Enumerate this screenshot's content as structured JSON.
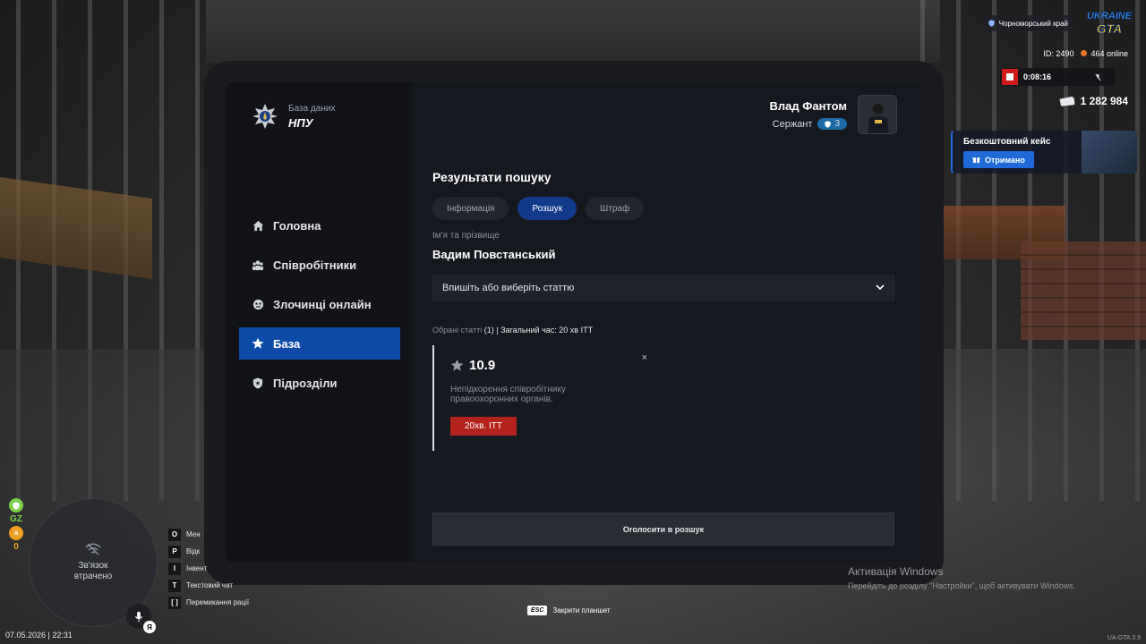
{
  "app": {
    "brand_sub": "База даних",
    "brand_title": "НПУ"
  },
  "user": {
    "name": "Влад Фантом",
    "rank": "Сержант",
    "rank_level": "3"
  },
  "nav": {
    "items": [
      {
        "label": "Головна",
        "icon": "home-icon",
        "active": false
      },
      {
        "label": "Співробітники",
        "icon": "people-icon",
        "active": false
      },
      {
        "label": "Злочинці онлайн",
        "icon": "mask-icon",
        "active": false
      },
      {
        "label": "База",
        "icon": "star-icon",
        "active": true
      },
      {
        "label": "Підрозділи",
        "icon": "shield-icon",
        "active": false
      }
    ]
  },
  "main": {
    "title": "Результати пошуку",
    "tabs": [
      {
        "label": "Інформація",
        "active": false
      },
      {
        "label": "Розшук",
        "active": true
      },
      {
        "label": "Штраф",
        "active": false
      }
    ],
    "name_label": "Ім'я та прізвище",
    "person_name": "Вадим Повстанський",
    "select_placeholder": "Впишіть або виберіть статтю",
    "summary_label": "Обрані статті",
    "summary_count": "(1)",
    "summary_total": "| Загальний час: 20 хв ІТТ",
    "article": {
      "number": "10.9",
      "description": "Непідкорення співробітнику правоохоронних органів.",
      "time": "20хв. ІТТ",
      "close": "×"
    },
    "submit_label": "Оголосити в розшук"
  },
  "hud": {
    "region": "Чорноморський край",
    "logo_text": "UKRAINE GTA",
    "id": "ID: 2490",
    "online": "464 online",
    "timer": "0:08:16",
    "money": "1 282 984",
    "case_title": "Безкоштовний кейс",
    "case_button": "Отримано",
    "connection_lost": "Зв'язок втрачено",
    "gz_label": "GZ",
    "zero": "0",
    "mic_key": "Я",
    "keys": [
      {
        "key": "O",
        "label": "Мен"
      },
      {
        "key": "P",
        "label": "Відк"
      },
      {
        "key": "I",
        "label": "Інвент"
      },
      {
        "key": "T",
        "label": "Текстовий чат"
      },
      {
        "key": "[ ]",
        "label": "Перемикання рації"
      }
    ],
    "esc_key": "ESC",
    "esc_label": "Закрити планшет",
    "datetime": "07.05.2026 | 22:31",
    "version": "UA-GTA 3.9"
  },
  "windows": {
    "activation_title": "Активація Windows",
    "activation_sub": "Перейдіть до розділу \"Настройки\", щоб активувати Windows."
  },
  "colors": {
    "accent": "#0e4aa8",
    "tab_active": "#133a8a",
    "danger": "#b4221d",
    "rank_badge": "#1e6aa6"
  }
}
